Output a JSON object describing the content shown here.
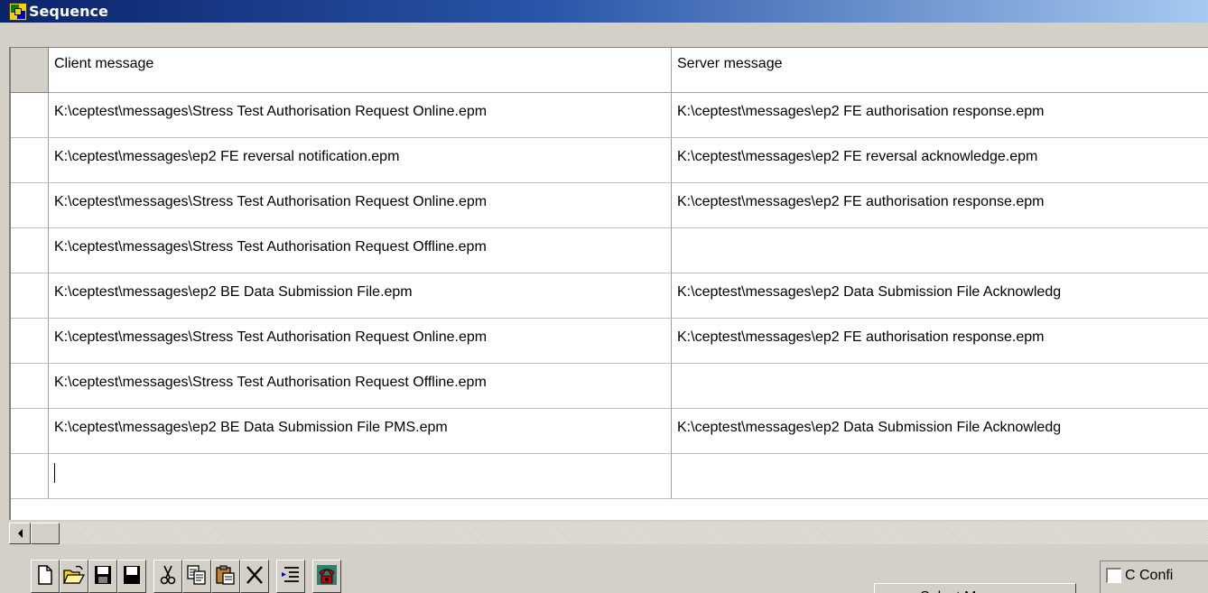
{
  "window": {
    "title": "Sequence"
  },
  "grid": {
    "columns": [
      "Client message",
      "Server message"
    ],
    "rows": [
      {
        "client": "K:\\ceptest\\messages\\Stress Test Authorisation Request Online.epm",
        "server": "K:\\ceptest\\messages\\ep2 FE authorisation response.epm"
      },
      {
        "client": "K:\\ceptest\\messages\\ep2 FE reversal notification.epm",
        "server": "K:\\ceptest\\messages\\ep2 FE reversal acknowledge.epm"
      },
      {
        "client": "K:\\ceptest\\messages\\Stress Test Authorisation Request Online.epm",
        "server": "K:\\ceptest\\messages\\ep2 FE authorisation response.epm"
      },
      {
        "client": "K:\\ceptest\\messages\\Stress Test Authorisation Request Offline.epm",
        "server": ""
      },
      {
        "client": "K:\\ceptest\\messages\\ep2 BE Data Submission File.epm",
        "server": "K:\\ceptest\\messages\\ep2 Data Submission File Acknowledg"
      },
      {
        "client": "K:\\ceptest\\messages\\Stress Test Authorisation Request Online.epm",
        "server": "K:\\ceptest\\messages\\ep2 FE authorisation response.epm"
      },
      {
        "client": "K:\\ceptest\\messages\\Stress Test Authorisation Request Offline.epm",
        "server": ""
      },
      {
        "client": "K:\\ceptest\\messages\\ep2 BE Data Submission File PMS.epm",
        "server": "K:\\ceptest\\messages\\ep2 Data Submission File Acknowledg"
      },
      {
        "client": "",
        "server": ""
      }
    ]
  },
  "toolbar": {
    "icons": [
      "new-file-icon",
      "open-folder-icon",
      "save-icon",
      "save-as-icon",
      "cut-icon",
      "copy-icon",
      "paste-icon",
      "delete-icon",
      "insert-row-icon",
      "telephone-icon"
    ],
    "select_messages_label": "Select Messages",
    "confirm_label": "C Confi"
  },
  "colors": {
    "title_gradient_start": "#0a246a",
    "title_gradient_end": "#a6caf0",
    "face": "#d4d0c8"
  }
}
